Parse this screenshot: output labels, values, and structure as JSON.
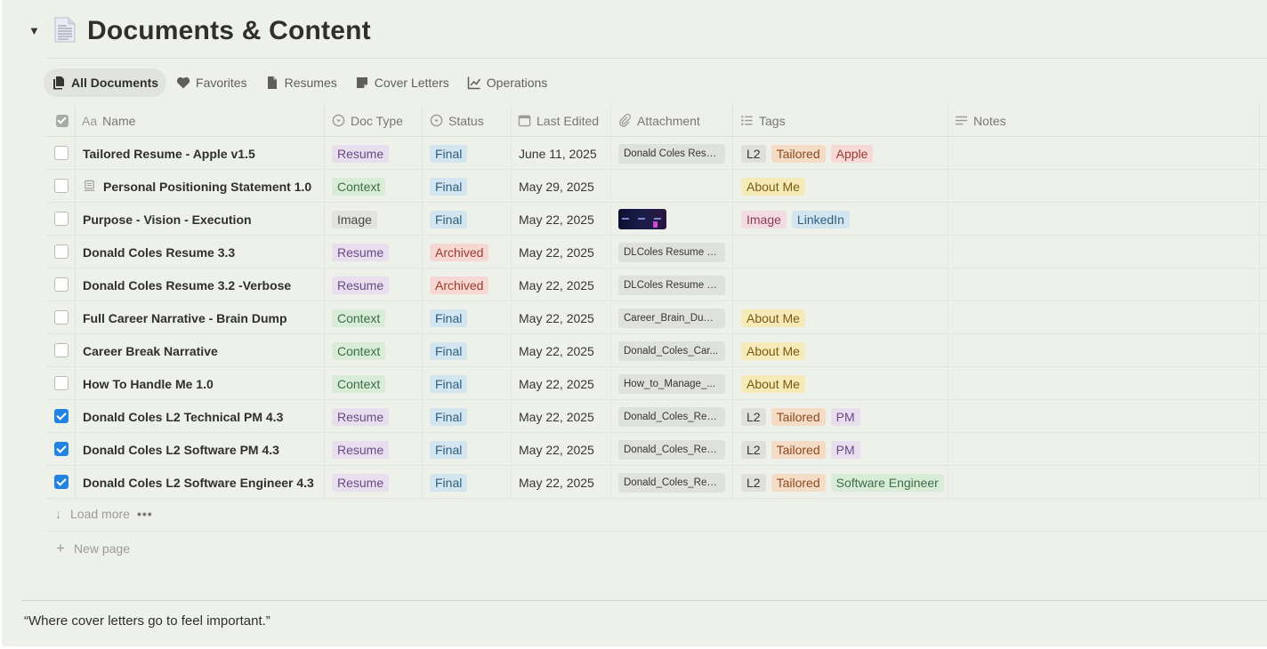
{
  "section": {
    "title": "Documents & Content",
    "toggle_glyph": "▼"
  },
  "tabs": [
    {
      "label": "All Documents",
      "icon": "documents-icon",
      "active": true
    },
    {
      "label": "Favorites",
      "icon": "heart-icon",
      "active": false
    },
    {
      "label": "Resumes",
      "icon": "file-icon",
      "active": false
    },
    {
      "label": "Cover Letters",
      "icon": "sticky-note-icon",
      "active": false
    },
    {
      "label": "Operations",
      "icon": "line-chart-icon",
      "active": false
    }
  ],
  "columns": {
    "name": "Name",
    "doc_type": "Doc Type",
    "status": "Status",
    "last_edited": "Last Edited",
    "attachment": "Attachment",
    "tags": "Tags",
    "notes": "Notes"
  },
  "colors": {
    "Resume": {
      "bg": "#e8deee",
      "fg": "#6a4a86"
    },
    "Context": {
      "bg": "#d8ecd8",
      "fg": "#3c6e45"
    },
    "Image": {
      "bg": "#e2e2de",
      "fg": "#4a4945"
    },
    "Final": {
      "bg": "#d3e5ef",
      "fg": "#2f5f80"
    },
    "Archived": {
      "bg": "#f6d7d2",
      "fg": "#9d3a2e"
    },
    "L2": {
      "bg": "#dfe0dc",
      "fg": "#37352f"
    },
    "Tailored": {
      "bg": "#f5dcc7",
      "fg": "#8a4a1d"
    },
    "Apple": {
      "bg": "#f7d9d6",
      "fg": "#9a3a34"
    },
    "About Me": {
      "bg": "#f7eab9",
      "fg": "#7a5a10"
    },
    "Image Tag": {
      "bg": "#f3dbe2",
      "fg": "#8c3d5a"
    },
    "LinkedIn": {
      "bg": "#d3e5ef",
      "fg": "#2f5f80"
    },
    "PM": {
      "bg": "#e8deee",
      "fg": "#6a4a86"
    },
    "Software Engineer": {
      "bg": "#d8ecd8",
      "fg": "#3c6e45"
    }
  },
  "rows": [
    {
      "checked": false,
      "page_icon": false,
      "name": "Tailored Resume - Apple v1.5",
      "doc_type": "Resume",
      "status": "Final",
      "last_edited": "June 11, 2025",
      "attachment": "Donald Coles Resu...",
      "tags": [
        "L2",
        "Tailored",
        "Apple"
      ]
    },
    {
      "checked": false,
      "page_icon": true,
      "name": "Personal Positioning Statement 1.0",
      "doc_type": "Context",
      "status": "Final",
      "last_edited": "May 29, 2025",
      "attachment": "",
      "tags": [
        "About Me"
      ]
    },
    {
      "checked": false,
      "page_icon": false,
      "name": "Purpose - Vision - Execution",
      "doc_type": "Image",
      "status": "Final",
      "last_edited": "May 22, 2025",
      "attachment": "",
      "attachment_thumbnail": true,
      "tags": [
        "Image",
        "LinkedIn"
      ]
    },
    {
      "checked": false,
      "page_icon": false,
      "name": "Donald Coles Resume 3.3",
      "doc_type": "Resume",
      "status": "Archived",
      "last_edited": "May 22, 2025",
      "attachment": "DLColes Resume 3...",
      "tags": []
    },
    {
      "checked": false,
      "page_icon": false,
      "name": "Donald Coles Resume 3.2 -Verbose",
      "doc_type": "Resume",
      "status": "Archived",
      "last_edited": "May 22, 2025",
      "attachment": "DLColes Resume 3...",
      "tags": []
    },
    {
      "checked": false,
      "page_icon": false,
      "name": "Full Career Narrative - Brain Dump",
      "doc_type": "Context",
      "status": "Final",
      "last_edited": "May 22, 2025",
      "attachment": "Career_Brain_Dum...",
      "tags": [
        "About Me"
      ]
    },
    {
      "checked": false,
      "page_icon": false,
      "name": "Career Break Narrative",
      "doc_type": "Context",
      "status": "Final",
      "last_edited": "May 22, 2025",
      "attachment": "Donald_Coles_Car...",
      "tags": [
        "About Me"
      ]
    },
    {
      "checked": false,
      "page_icon": false,
      "name": "How To Handle Me 1.0",
      "doc_type": "Context",
      "status": "Final",
      "last_edited": "May 22, 2025",
      "attachment": "How_to_Manage_...",
      "tags": [
        "About Me"
      ]
    },
    {
      "checked": true,
      "page_icon": false,
      "name": "Donald Coles L2 Technical PM 4.3",
      "doc_type": "Resume",
      "status": "Final",
      "last_edited": "May 22, 2025",
      "attachment": "Donald_Coles_Res...",
      "tags": [
        "L2",
        "Tailored",
        "PM"
      ]
    },
    {
      "checked": true,
      "page_icon": false,
      "name": "Donald Coles L2 Software PM 4.3",
      "doc_type": "Resume",
      "status": "Final",
      "last_edited": "May 22, 2025",
      "attachment": "Donald_Coles_Res...",
      "tags": [
        "L2",
        "Tailored",
        "PM"
      ]
    },
    {
      "checked": true,
      "page_icon": false,
      "name": "Donald Coles L2 Software Engineer 4.3",
      "doc_type": "Resume",
      "status": "Final",
      "last_edited": "May 22, 2025",
      "attachment": "Donald_Coles_Res...",
      "tags": [
        "L2",
        "Tailored",
        "Software Engineer"
      ]
    }
  ],
  "footer": {
    "load_more": "Load more",
    "load_more_dots": "•••",
    "new_page": "New page",
    "quote": "“Where cover letters go to feel important.”"
  }
}
